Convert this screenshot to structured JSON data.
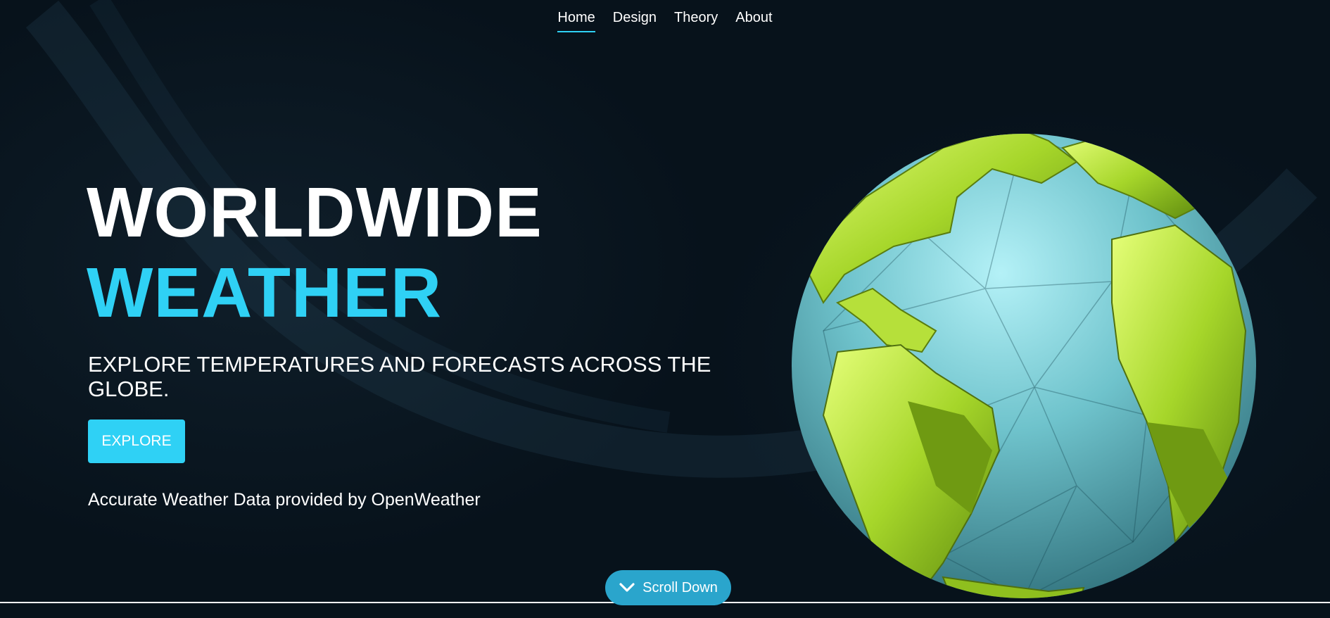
{
  "nav": {
    "items": [
      {
        "label": "Home",
        "active": true
      },
      {
        "label": "Design",
        "active": false
      },
      {
        "label": "Theory",
        "active": false
      },
      {
        "label": "About",
        "active": false
      }
    ]
  },
  "hero": {
    "title_line1": "WORLDWIDE",
    "title_line2": "WEATHER",
    "subtitle": "EXPLORE TEMPERATURES AND FORECASTS ACROSS THE GLOBE.",
    "explore_label": "EXPLORE",
    "provided_text": "Accurate Weather Data provided by OpenWeather"
  },
  "scroll": {
    "label": "Scroll Down",
    "icon": "chevron-down-icon"
  },
  "colors": {
    "background": "#07121b",
    "accent": "#2fd1f5",
    "scroll_button": "#2aa5cc",
    "land": "#a6d62a",
    "ocean": "#6fc3cc"
  }
}
